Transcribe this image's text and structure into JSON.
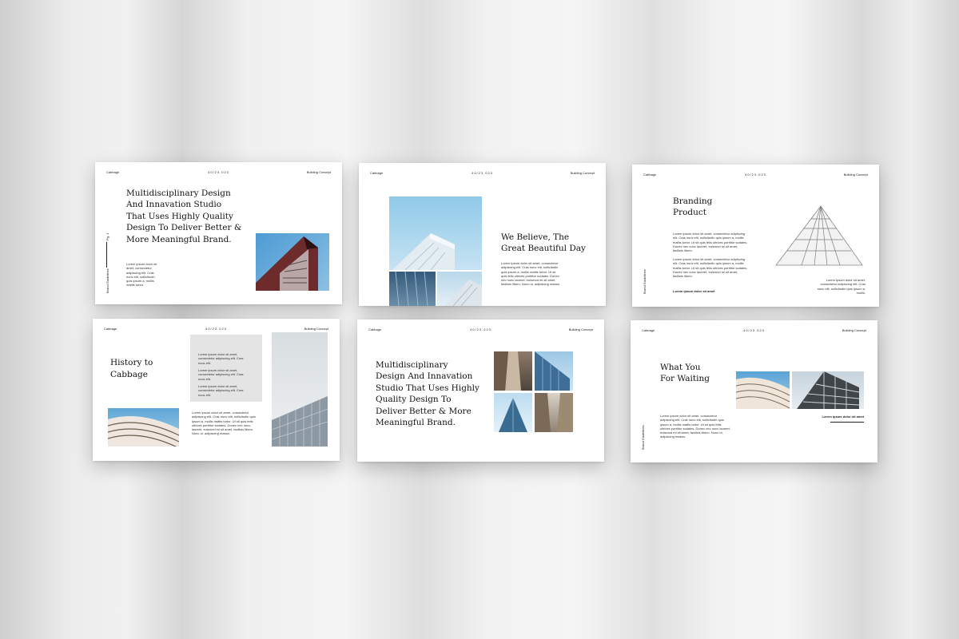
{
  "slides": [
    {
      "header": {
        "brand": "Cabbage",
        "number": "40/23.023",
        "topic": "Building Concept"
      },
      "title_lines": [
        "Multidisciplinary Design",
        "And Innavation Studio",
        "That  Uses Highly Quality",
        "Design To Deliver Better &",
        "More Meaningful Brand."
      ],
      "body": "Lorem ipsum dolor sit amet, consectetur adipiscing elit. Cras nunc elit, sollicitudin quis ipsum a, mollis mattis tortor.",
      "page_label": "Pg. 1",
      "side_label": "Brand Guidelines"
    },
    {
      "header": {
        "brand": "Cabbage",
        "number": "40/23.023",
        "topic": "Building Concept"
      },
      "title_lines": [
        "We Believe, The",
        "Great Beautiful Day"
      ],
      "body": "Lorem ipsum dolor sit amet, consectetur adipiscing elit. Cras nunc elit, sollicitudin quis ipsum a, mollis mattis tortor. Ut sit quis felis ultrices porttitor sodales. Donec nec nunc laoreet, euismod mi sit amet, facilisis libero. Nunc ut, adipiscing massa."
    },
    {
      "header": {
        "brand": "Cabbage",
        "number": "40/23.023",
        "topic": "Building Concept"
      },
      "title_lines": [
        "Branding",
        "Product"
      ],
      "body1": "Lorem ipsum dolor sit amet, consectetur adipiscing elit. Cras nunc elit, sollicitudin quis ipsum a, mollis mattis tortor. Ut sit quis felis ultrices porttitor sodales. Donec nec nunc laoreet, euismod mi sit amet, facilisis libero.",
      "body2": "Lorem ipsum dolor sit amet, consectetur adipiscing elit. Cras nunc elit, sollicitudin quis ipsum a, mollis mattis tortor. Ut sit quis felis ultrices porttitor sodales. Donec nec nunc laoreet, euismod mi sit amet, facilisis libero.",
      "caption": "Lorem ipsum dolor sit amet, consectetur adipiscing elit. Cras nunc elit, sollicitudin quis ipsum a, mollis.",
      "label": "Lorem ipsum dolor sit amet",
      "side_label": "Brand Guidelines"
    },
    {
      "header": {
        "brand": "Cabbage",
        "number": "40/23.023",
        "topic": "Building Concept"
      },
      "title_lines": [
        "History to",
        "Cabbage"
      ],
      "box_items": [
        "Lorem ipsum dolor sit amet, consectetur adipiscing elit. Cras nunc elit.",
        "Lorem ipsum dolor sit amet, consectetur adipiscing elit. Cras nunc elit.",
        "Lorem ipsum dolor sit amet, consectetur adipiscing elit. Cras nunc elit."
      ],
      "body": "Lorem ipsum dolor sit amet, consectetur adipiscing elit. Cras nunc elit, sollicitudin quis ipsum a, mollis mattis tortor. Ut sit quis felis ultrices porttitor sodales. Donec nec nunc laoreet, euismod mi sit amet, facilisis libero. Nunc ut, adipiscing massa."
    },
    {
      "header": {
        "brand": "Cabbage",
        "number": "40/23.023",
        "topic": "Building Concept"
      },
      "title_lines": [
        "Multidisciplinary",
        "Design And Innavation",
        "Studio That Uses Highly",
        "Quality Design To",
        "Deliver Better & More",
        "Meaningful Brand."
      ]
    },
    {
      "header": {
        "brand": "Cabbage",
        "number": "40/23.023",
        "topic": "Building Concept"
      },
      "title_lines": [
        "What You",
        "For Waiting"
      ],
      "label": "Lorem ipsum dolor sit amet",
      "body": "Lorem ipsum dolor sit amet, consectetur adipiscing elit. Cras nunc elit, sollicitudin quis ipsum a, mollis mattis tortor. Ut sit quis felis ultrices porttitor sodales. Donec nec nunc laoreet, euismod mi sit amet, facilisis libero. Nunc ut, adipiscing massa.",
      "side_label": "Brand Guidelines"
    }
  ]
}
